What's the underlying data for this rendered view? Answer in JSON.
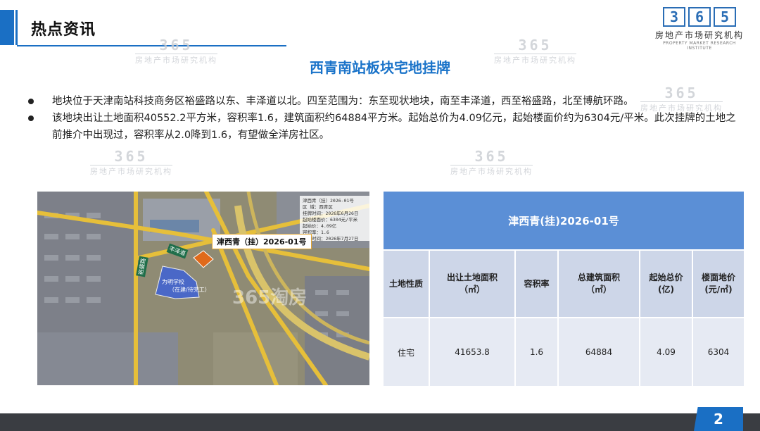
{
  "header": {
    "title": "热点资讯"
  },
  "logo": {
    "number": [
      "3",
      "6",
      "5"
    ],
    "cn": "房地产市场研究机构",
    "en": "PROPERTY MARKET RESEARCH INSTITUTE"
  },
  "subtitle": "西青南站板块宅地挂牌",
  "bullets": [
    "地块位于天津南站科技商务区裕盛路以东、丰泽道以北。四至范围为：东至现状地块，南至丰泽道，西至裕盛路，北至博航环路。",
    "该地块出让土地面积40552.2平方米，容积率1.6，建筑面积约64884平方米。起始总价为4.09亿元，起始楼面价约为6304元/平米。此次挂牌的土地之前推介中出现过，容积率从2.0降到1.6，有望做全洋房社区。"
  ],
  "map": {
    "plot_label": "津西青（挂）2026-01号",
    "callout_lines": [
      "津西青（挂）2026-01号",
      "区 域：西青区",
      "挂牌时间：2026年6月26日",
      "起始楼面价：6304元/平米",
      "起始价：4.09亿",
      "容积率：1.6",
      "截止时间：2026年7月27日"
    ],
    "road_tag_1": "丰泽道",
    "road_tag_2": "裕盛路",
    "school_line1": "为明学校",
    "school_line2": "（在建/待完工）",
    "watermark": "365淘房"
  },
  "table": {
    "title": "津西青(挂)2026-01号",
    "headers": [
      "土地性质",
      "出让土地面积\n（㎡）",
      "容积率",
      "总建筑面积\n（㎡）",
      "起始总价\n(亿)",
      "楼面地价\n(元/㎡)"
    ],
    "row": [
      "住宅",
      "41653.8",
      "1.6",
      "64884",
      "4.09",
      "6304"
    ]
  },
  "watermark_text": {
    "number": "365",
    "cn": "房地产市场研究机构"
  },
  "footer": {
    "page": "2"
  }
}
